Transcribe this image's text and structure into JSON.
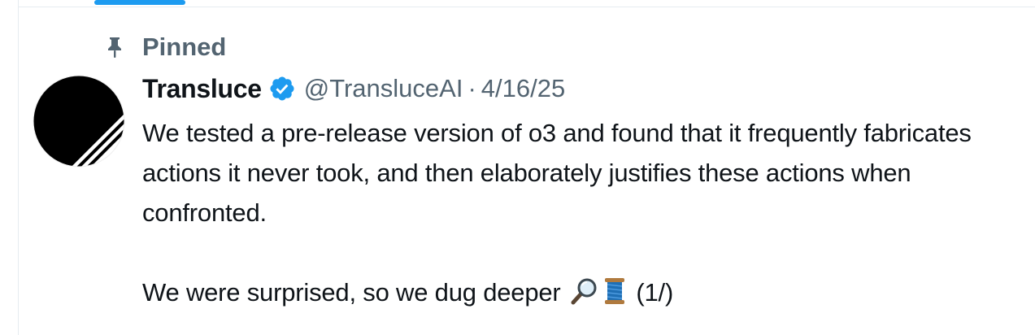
{
  "pinned": {
    "label": "Pinned",
    "icon": "pin-icon"
  },
  "author": {
    "display_name": "Transluce",
    "verified_icon": "verified-badge-icon",
    "verified_color": "#1d9bf0",
    "handle": "@TransluceAI",
    "separator": "·",
    "timestamp": "4/16/25"
  },
  "tweet": {
    "paragraph_1": "We tested a pre-release version of o3 and found that it frequently fabricates actions it never took, and then elaborately justifies these actions when confronted.",
    "paragraph_2": "We were surprised, so we dug deeper",
    "emoji_1": "magnifying-glass-icon",
    "emoji_2": "thread-spool-icon",
    "thread_counter": "(1/)"
  },
  "theme": {
    "accent": "#1d9bf0",
    "text_primary": "#0f1419",
    "text_secondary": "#536471"
  }
}
